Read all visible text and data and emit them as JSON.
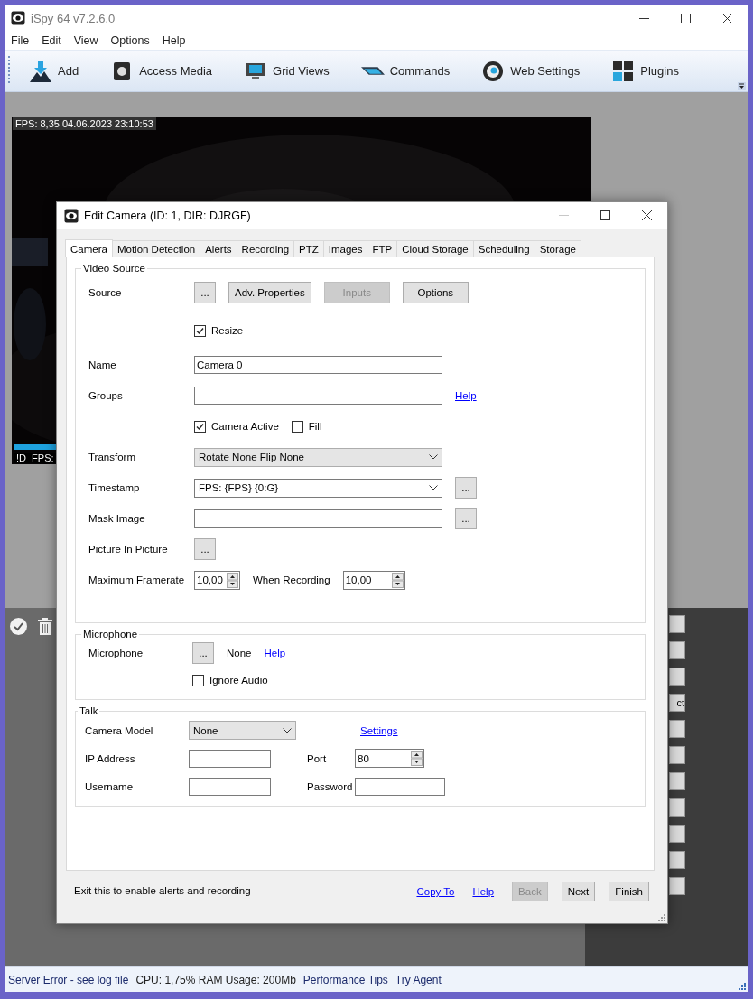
{
  "window": {
    "title": "iSpy 64 v7.2.6.0"
  },
  "menu": [
    "File",
    "Edit",
    "View",
    "Options",
    "Help"
  ],
  "toolbar": [
    {
      "label": "Add",
      "kind": "add"
    },
    {
      "label": "Access Media",
      "kind": "media"
    },
    {
      "label": "Grid Views",
      "kind": "grid"
    },
    {
      "label": "Commands",
      "kind": "commands"
    },
    {
      "label": "Web Settings",
      "kind": "web"
    },
    {
      "label": "Plugins",
      "kind": "plugins"
    }
  ],
  "camera_tile": {
    "overlay": "FPS: 8,35 04.06.2023 23:10:53",
    "footer": "!D  FPS:"
  },
  "side_panel": {
    "button_label": "ct"
  },
  "dialog": {
    "title": "Edit Camera (ID: 1, DIR: DJRGF)",
    "tabs": [
      {
        "label": "Camera",
        "selected": true
      },
      {
        "label": "Motion Detection",
        "selected": false
      },
      {
        "label": "Alerts",
        "selected": false
      },
      {
        "label": "Recording",
        "selected": false
      },
      {
        "label": "PTZ",
        "selected": false
      },
      {
        "label": "Images",
        "selected": false
      },
      {
        "label": "FTP",
        "selected": false
      },
      {
        "label": "Cloud Storage",
        "selected": false
      },
      {
        "label": "Scheduling",
        "selected": false
      },
      {
        "label": "Storage",
        "selected": false
      }
    ],
    "video_source": {
      "title": "Video Source",
      "rows": [
        {
          "label": "Source",
          "controls": [
            {
              "kind": "button",
              "text": "...",
              "disabled": false
            },
            {
              "kind": "button",
              "text": "Adv. Properties",
              "disabled": false
            },
            {
              "kind": "button",
              "text": "Inputs",
              "disabled": true
            },
            {
              "kind": "button",
              "text": "Options",
              "disabled": false
            }
          ]
        },
        {
          "controls": [
            {
              "kind": "checkbox",
              "text": "Resize",
              "checked": true
            }
          ]
        },
        {
          "label": "Name",
          "controls": [
            {
              "kind": "input",
              "value": "Camera 0"
            }
          ]
        },
        {
          "label": "Groups",
          "controls": [
            {
              "kind": "input"
            },
            {
              "kind": "link",
              "text": "Help"
            }
          ]
        },
        {
          "controls": [
            {
              "kind": "checkbox",
              "text": "Camera Active",
              "checked": true
            },
            {
              "kind": "checkbox",
              "text": "Fill",
              "checked": false
            }
          ]
        },
        {
          "label": "Transform",
          "controls": [
            {
              "kind": "select",
              "value": "Rotate None Flip None"
            }
          ]
        },
        {
          "label": "Timestamp",
          "controls": [
            {
              "kind": "combo",
              "value": "FPS: {FPS} {0:G}"
            },
            {
              "kind": "button",
              "text": "...",
              "disabled": false
            }
          ]
        },
        {
          "label": "Mask Image",
          "controls": [
            {
              "kind": "input"
            },
            {
              "kind": "button",
              "text": "...",
              "disabled": false
            }
          ]
        },
        {
          "label": "Picture In Picture",
          "controls": [
            {
              "kind": "button",
              "text": "...",
              "disabled": false
            }
          ]
        },
        {
          "label": "Maximum Framerate",
          "controls": [
            {
              "kind": "spinner",
              "value": "10,00"
            },
            {
              "kind": "text",
              "text": "When Recording"
            },
            {
              "kind": "spinner",
              "value": "10,00"
            }
          ]
        }
      ]
    },
    "microphone": {
      "title": "Microphone",
      "rows": [
        {
          "label": "Microphone",
          "controls": [
            {
              "kind": "button",
              "text": "...",
              "disabled": false
            },
            {
              "kind": "text",
              "text": "None"
            },
            {
              "kind": "link",
              "text": "Help"
            }
          ]
        },
        {
          "controls": [
            {
              "kind": "checkbox",
              "text": "Ignore Audio",
              "checked": false
            }
          ]
        }
      ]
    },
    "talk": {
      "title": "Talk",
      "rows": [
        {
          "label": "Camera Model",
          "control": {
            "kind": "select",
            "value": "None"
          },
          "control_2": {
            "kind": "link",
            "text": "Settings"
          }
        },
        {
          "label": "IP Address",
          "control": {
            "kind": "input"
          },
          "label_2": "Port",
          "control_2": {
            "kind": "spinner",
            "value": "80"
          }
        },
        {
          "label": "Username",
          "control": {
            "kind": "input"
          },
          "label_2": "Password",
          "control_2": {
            "kind": "input"
          }
        }
      ]
    },
    "hint": "Exit this to enable alerts and recording",
    "links": [
      "Copy To",
      "Help"
    ],
    "buttons": [
      {
        "label": "Back",
        "disabled": true
      },
      {
        "label": "Next",
        "disabled": false
      },
      {
        "label": "Finish",
        "disabled": false
      }
    ]
  },
  "status_bar": [
    {
      "text": "Server Error - see log file",
      "kind": "link"
    },
    {
      "text": "CPU: 1,75% RAM Usage: 200Mb",
      "kind": "text"
    },
    {
      "text": "Performance Tips",
      "kind": "link"
    },
    {
      "text": "Try Agent",
      "kind": "link"
    }
  ]
}
